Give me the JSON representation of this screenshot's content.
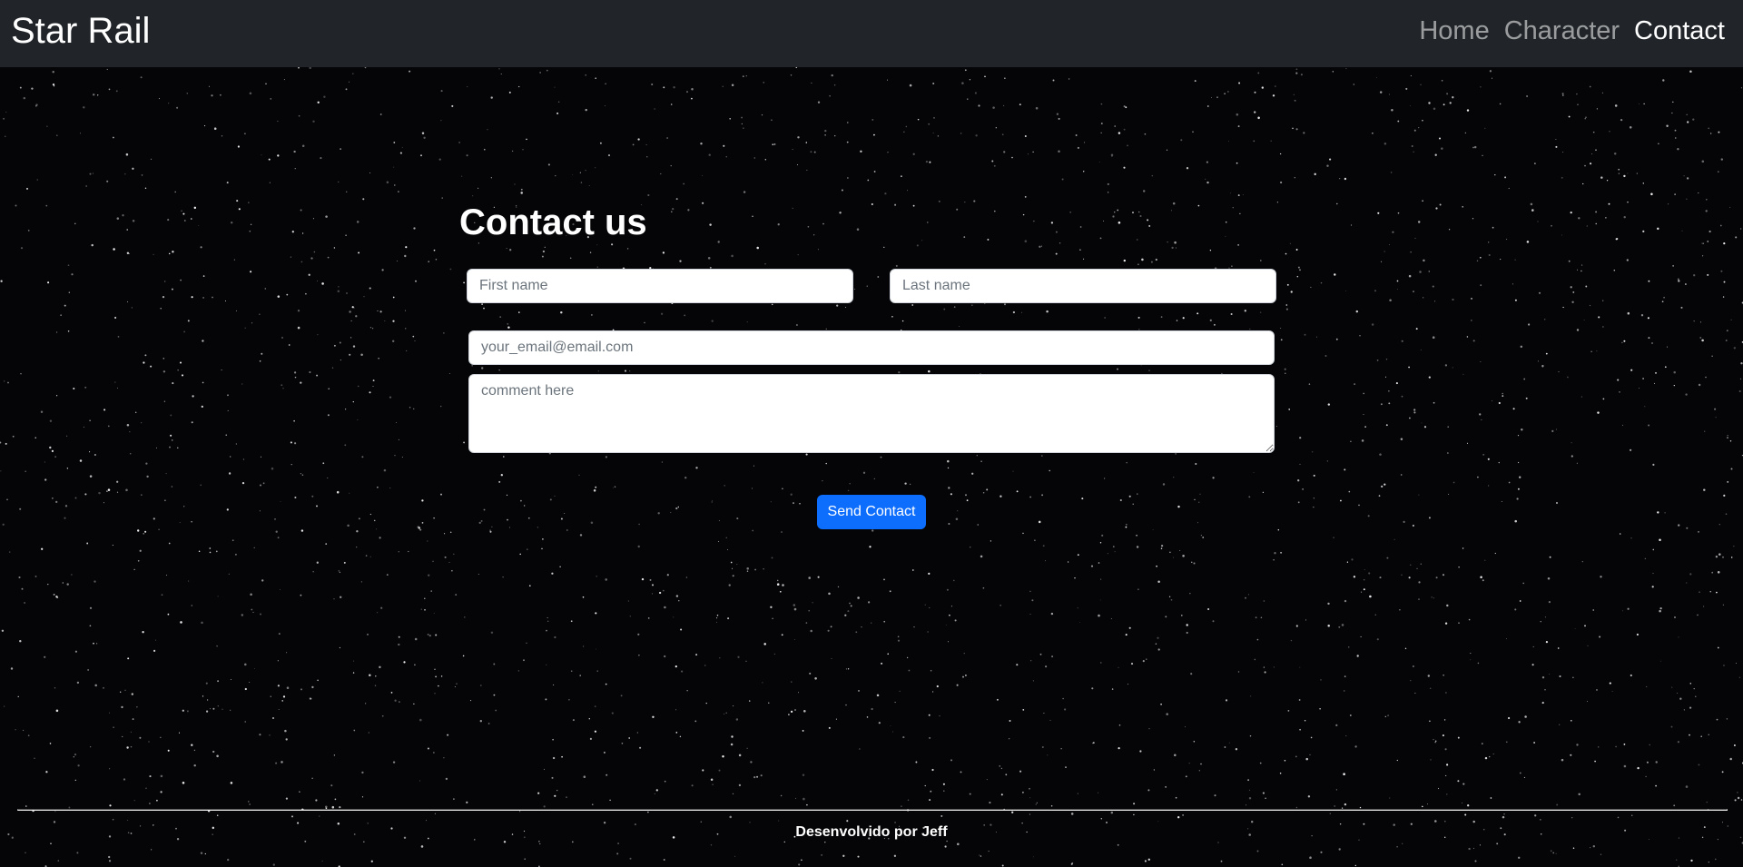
{
  "navbar": {
    "brand": "Star Rail",
    "links": [
      {
        "label": "Home",
        "active": false
      },
      {
        "label": "Character",
        "active": false
      },
      {
        "label": "Contact",
        "active": true
      }
    ],
    "background_color": "#212529"
  },
  "contact_form": {
    "title": "Contact us",
    "first_name_placeholder": "First name",
    "last_name_placeholder": "Last name",
    "email_placeholder": "your_email@email.com",
    "comment_placeholder": "comment here",
    "submit_label": "Send Contact",
    "submit_color": "#0d6efd"
  },
  "footer": {
    "text": "Desenvolvido por Jeff"
  },
  "background": {
    "style": "starfield",
    "color": "#050507"
  }
}
